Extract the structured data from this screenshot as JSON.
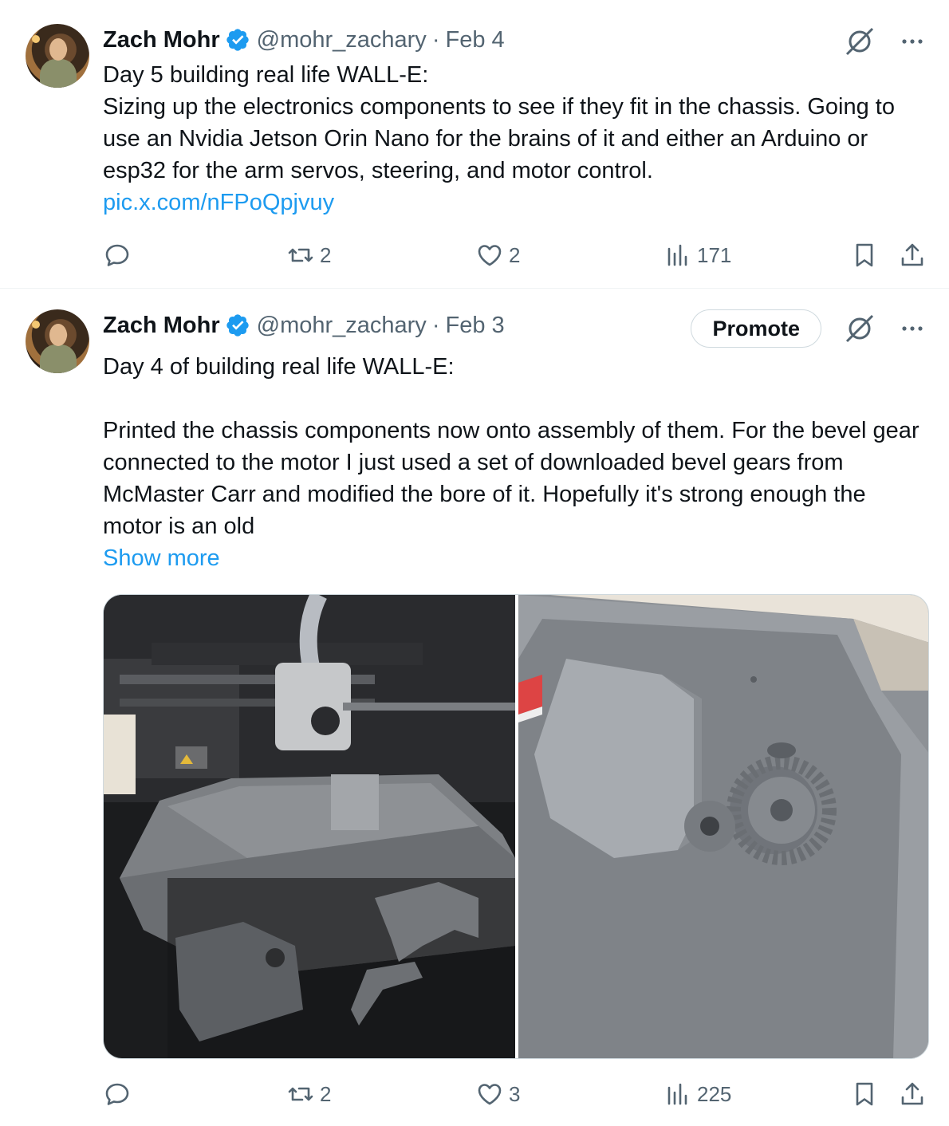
{
  "tweets": [
    {
      "author_name": "Zach Mohr",
      "handle": "@mohr_zachary",
      "separator": "·",
      "date": "Feb 4",
      "text_lines": [
        "Day 5 building real life WALL-E:",
        "Sizing up the electronics components to see if they fit in the chassis. Going to use an Nvidia Jetson Orin Nano for the brains of it and either an Arduino or esp32 for the arm servos, steering, and motor control."
      ],
      "link": "pic.x.com/nFPoQpjvuy",
      "stats": {
        "replies": "",
        "reposts": "2",
        "likes": "2",
        "views": "171"
      }
    },
    {
      "author_name": "Zach Mohr",
      "handle": "@mohr_zachary",
      "separator": "·",
      "date": "Feb 3",
      "promote_label": "Promote",
      "text_lines": [
        "Day 4 of building real life WALL-E:",
        "",
        "Printed the chassis components now onto assembly of them. For the bevel gear connected to the motor I just used a set of downloaded bevel gears from McMaster Carr and modified the bore of it. Hopefully it's strong enough the motor is an old"
      ],
      "show_more": "Show more",
      "stats": {
        "replies": "",
        "reposts": "2",
        "likes": "3",
        "views": "225"
      }
    }
  ],
  "icons": {
    "verified": "verified-badge-icon",
    "grok": "grok-icon",
    "more": "more-icon",
    "reply": "reply-icon",
    "repost": "repost-icon",
    "like": "like-icon",
    "views": "views-icon",
    "bookmark": "bookmark-icon",
    "share": "share-icon"
  },
  "colors": {
    "link": "#1d9bf0",
    "verified": "#1d9bf0",
    "secondary_text": "#536471"
  }
}
